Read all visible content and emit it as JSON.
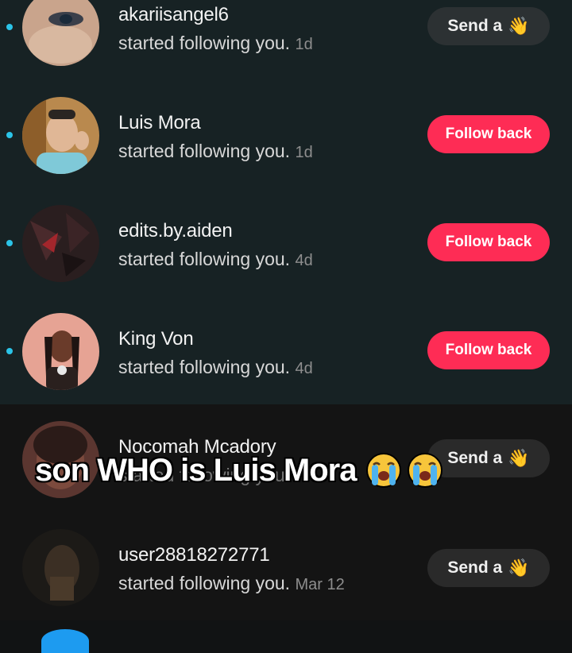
{
  "notifications": [
    {
      "username": "akariisangel6",
      "text": "started following you.",
      "time": "1d",
      "button": "Send a",
      "button_icon": "waving-hand-icon",
      "unread": true
    },
    {
      "username": "Luis Mora",
      "text": "started following you.",
      "time": "1d",
      "button": "Follow back",
      "unread": true
    },
    {
      "username": "edits.by.aiden",
      "text": "started following you.",
      "time": "4d",
      "button": "Follow back",
      "unread": true
    },
    {
      "username": "King Von",
      "text": "started following you.",
      "time": "4d",
      "button": "Follow back",
      "unread": true
    },
    {
      "username": "Nocomah Mcadory",
      "text": "started following you.",
      "time": "",
      "button": "Send a",
      "button_icon": "waving-hand-icon",
      "unread": false
    },
    {
      "username": "user28818272771",
      "text": "started following you.",
      "time": "Mar 12",
      "button": "Send a",
      "button_icon": "waving-hand-icon",
      "unread": false
    }
  ],
  "overlay_caption": {
    "text": "son WHO is Luis Mora",
    "emojis": [
      "loudly-crying-face-icon",
      "loudly-crying-face-icon"
    ]
  },
  "colors": {
    "unread_bg": "#172224",
    "read_bg": "#141414",
    "follow_button": "#fe2c55",
    "unread_dot": "#2bc4e8"
  }
}
